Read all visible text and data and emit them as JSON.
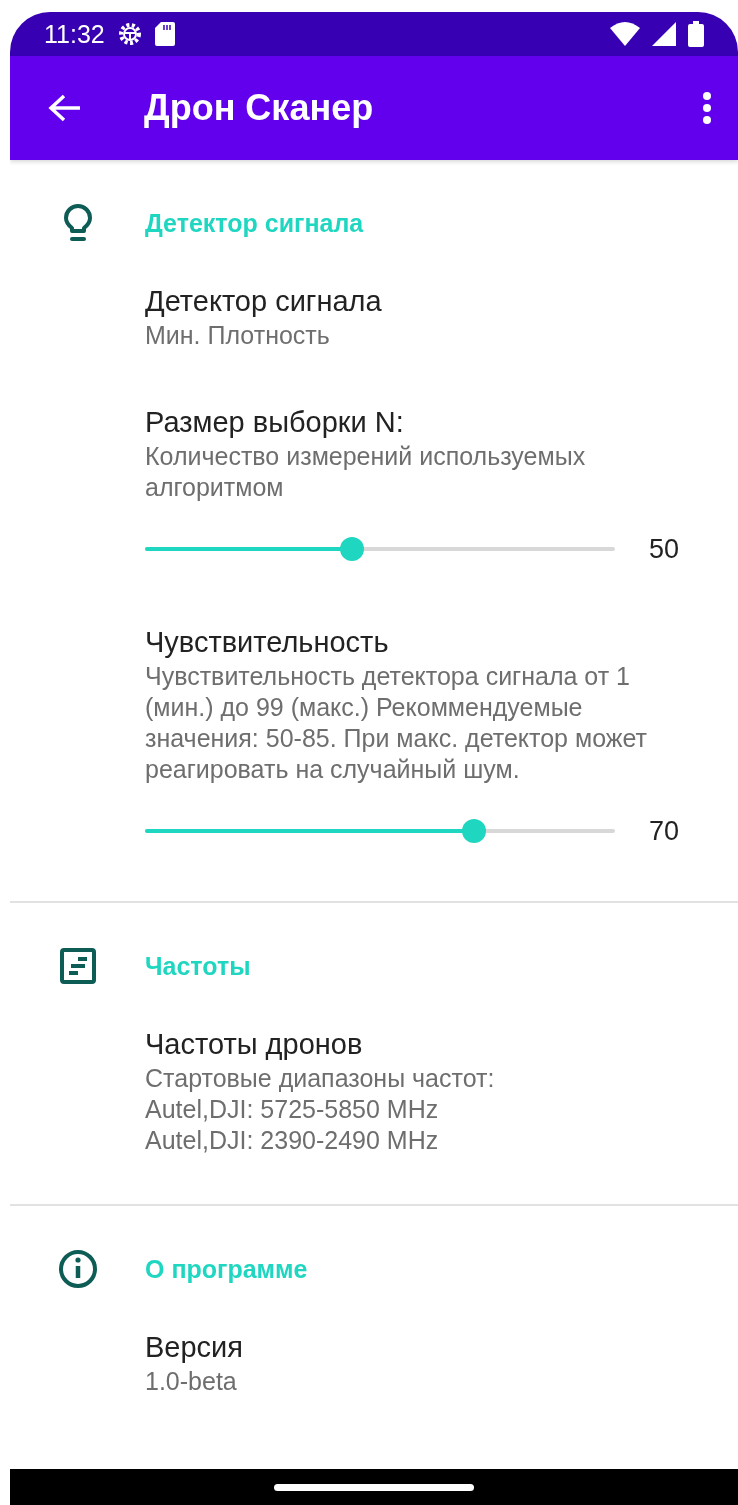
{
  "status_bar": {
    "time": "11:32"
  },
  "app_bar": {
    "title": "Дрон Сканер"
  },
  "sections": [
    {
      "title": "Детектор сигнала",
      "items": [
        {
          "kind": "text",
          "title": "Детектор сигнала",
          "summary": "Мин. Плотность"
        },
        {
          "kind": "slider",
          "title": "Размер выборки N:",
          "summary": "Количество измерений используемых алгоритмом",
          "level": 0.44,
          "reading": "50"
        },
        {
          "kind": "slider",
          "title": "Чувствительность",
          "summary": "Чувствительность детектора сигнала от 1 (мин.) до 99 (макс.) Рекоммендуемые значения: 50-85. При макс. детектор может реагировать на случайный шум.",
          "level": 0.7,
          "reading": "70"
        }
      ]
    },
    {
      "title": "Частоты",
      "items": [
        {
          "kind": "text",
          "title": "Частоты дронов",
          "summary": "Стартовые диапазоны частот:\nAutel,DJI: 5725-5850 MHz\nAutel,DJI: 2390-2490 MHz"
        }
      ]
    },
    {
      "title": "О программе",
      "items": [
        {
          "kind": "text",
          "title": "Версия",
          "summary": "1.0-beta"
        }
      ]
    }
  ]
}
